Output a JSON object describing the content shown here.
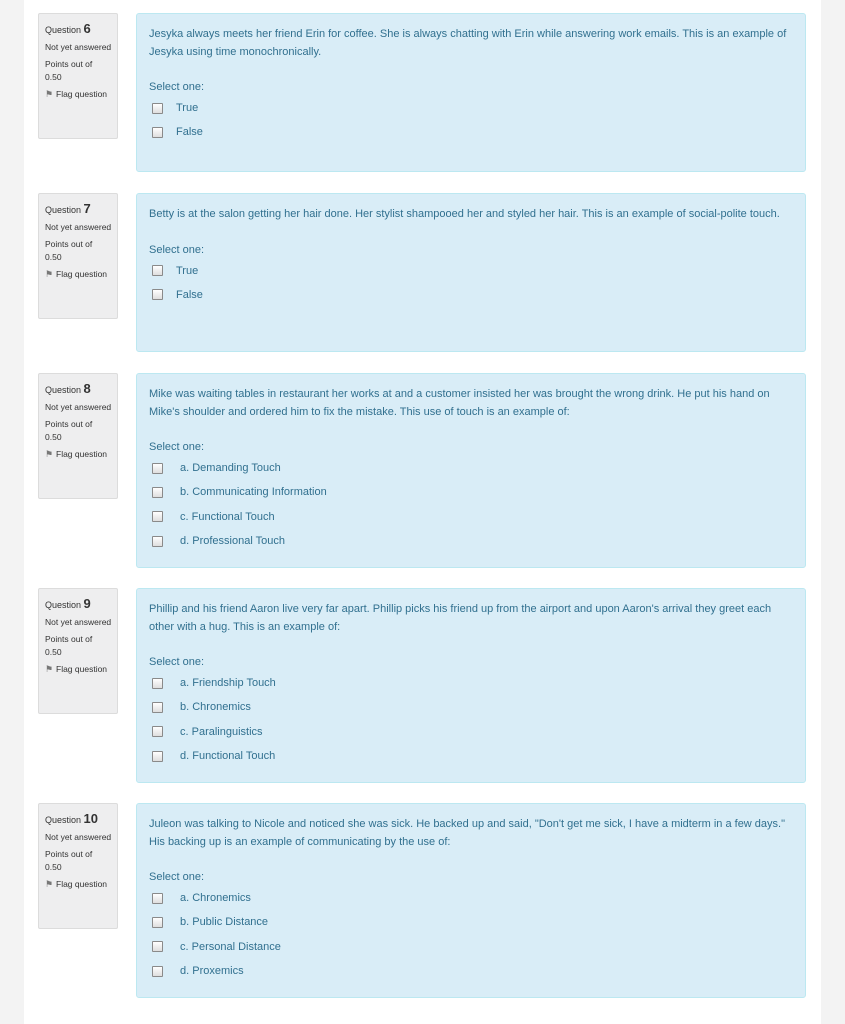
{
  "questions": [
    {
      "label": "Question",
      "number": "6",
      "state": "Not yet answered",
      "grade_label": "Points out of",
      "grade_value": "0.50",
      "flag_label": "Flag question",
      "text": "Jesyka always meets her friend Erin for coffee. She is always chatting with Erin while answering work emails. This is an example of Jesyka using time monochronically.",
      "prompt": "Select one:",
      "options": [
        "True",
        "False"
      ]
    },
    {
      "label": "Question",
      "number": "7",
      "state": "Not yet answered",
      "grade_label": "Points out of",
      "grade_value": "0.50",
      "flag_label": "Flag question",
      "text": "Betty is at the salon getting her hair done. Her stylist shampooed her and styled her hair. This is an example of social-polite touch.",
      "prompt": "Select one:",
      "options": [
        "True",
        "False"
      ]
    },
    {
      "label": "Question",
      "number": "8",
      "state": "Not yet answered",
      "grade_label": "Points out of",
      "grade_value": "0.50",
      "flag_label": "Flag question",
      "text": "Mike was waiting tables in restaurant her works at and a customer insisted her was brought the wrong drink. He put his hand on Mike's shoulder and ordered him to fix the mistake. This use of touch is an example of:",
      "prompt": "Select one:",
      "options": [
        "a. Demanding Touch",
        "b. Communicating Information",
        "c. Functional Touch",
        "d. Professional Touch"
      ]
    },
    {
      "label": "Question",
      "number": "9",
      "state": "Not yet answered",
      "grade_label": "Points out of",
      "grade_value": "0.50",
      "flag_label": "Flag question",
      "text": "Phillip and his friend Aaron live very far apart. Phillip picks his friend up from the airport and upon Aaron's arrival they greet each other with a hug. This is an example of:",
      "prompt": "Select one:",
      "options": [
        "a. Friendship Touch",
        "b. Chronemics",
        "c. Paralinguistics",
        "d. Functional Touch"
      ]
    },
    {
      "label": "Question",
      "number": "10",
      "state": "Not yet answered",
      "grade_label": "Points out of",
      "grade_value": "0.50",
      "flag_label": "Flag question",
      "text": "Juleon was talking to Nicole and noticed she was sick. He backed up and said, \"Don't get me sick, I have a midterm in a few days.\" His backing up is an example of communicating by the use of:",
      "prompt": "Select one:",
      "options": [
        "a. Chronemics",
        "b. Public Distance",
        "c. Personal Distance",
        "d. Proxemics"
      ]
    }
  ]
}
